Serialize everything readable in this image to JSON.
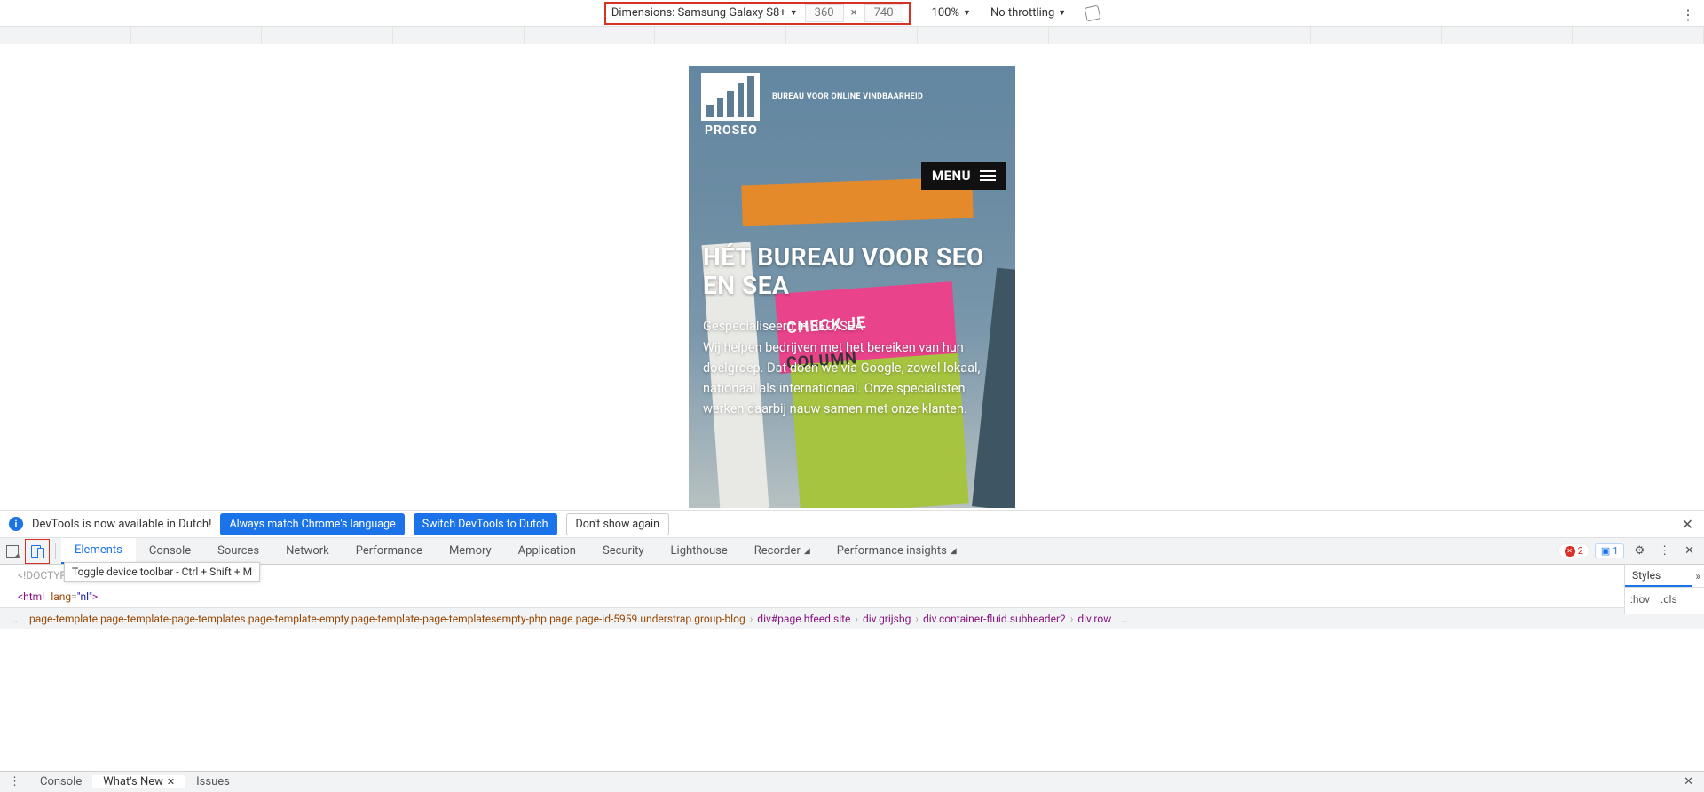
{
  "device_toolbar": {
    "dimensions_label": "Dimensions: Samsung Galaxy S8+",
    "width": "360",
    "height": "740",
    "zoom": "100%",
    "throttling": "No throttling"
  },
  "site": {
    "tagline": "BUREAU VOOR ONLINE VINDBAARHEID",
    "brand": "PROSEO",
    "menu_label": "MENU",
    "hero_title": "HÉT BUREAU VOOR SEO EN SEA",
    "hero_p1": "Gespecialiseerd in SEO/SEA",
    "hero_p2": "Wij helpen bedrijven met het bereiken van hun doelgroep. Dat doen we via Google, zowel lokaal,",
    "hero_p3": "nationaal als internationaal. Onze specialisten werken daarbij nauw samen met onze klanten.",
    "bg_text1": "CHECK JE",
    "bg_text2": "COLUMN"
  },
  "notice": {
    "text": "DevTools is now available in Dutch!",
    "btn1": "Always match Chrome's language",
    "btn2": "Switch DevTools to Dutch",
    "btn3": "Don't show again"
  },
  "devtools_tabs": [
    "Elements",
    "Console",
    "Sources",
    "Network",
    "Performance",
    "Memory",
    "Application",
    "Security",
    "Lighthouse",
    "Recorder",
    "Performance insights"
  ],
  "errors_count": "2",
  "messages_count": "1",
  "tooltip": "Toggle device toolbar - Ctrl + Shift + M",
  "source": {
    "doctype": "<!DOCTYPE html>",
    "open": "<html",
    "attr": "lang",
    "val": "\"nl\"",
    "close": ">"
  },
  "breadcrumb": {
    "body_classes": "page-template.page-template-page-templates.page-template-empty.page-template-page-templatesempty-php.page.page-id-5959.understrap.group-blog",
    "seg_page": "div#page.hfeed.site",
    "seg_grijs": "div.grijsbg",
    "seg_sub": "div.container-fluid.subheader2",
    "seg_row": "div.row"
  },
  "styles": {
    "tab": "Styles",
    "hov": ":hov",
    "cls": ".cls"
  },
  "drawer": {
    "tabs": [
      "Console",
      "What's New",
      "Issues"
    ]
  }
}
